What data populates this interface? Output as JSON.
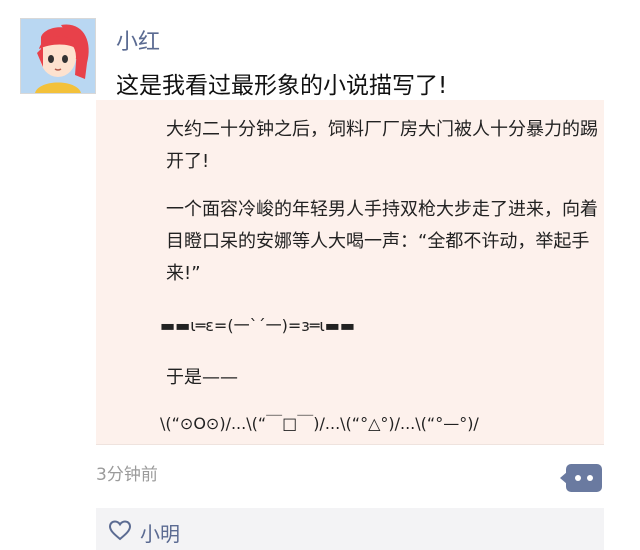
{
  "post": {
    "username": "小红",
    "text": "这是我看过最形象的小说描写了!",
    "timestamp": "3分钟前"
  },
  "image": {
    "paragraph1": "大约二十分钟之后，饲料厂厂房大门被人十分暴力的踢开了!",
    "paragraph2": "一个面容冷峻的年轻男人手持双枪大步走了进来，向着目瞪口呆的安娜等人大喝一声：“全都不许动，举起手来!”",
    "emoticon": "▬▬ι═ε=(一`´一)=з═ι▬▬",
    "paragraph3": "于是——",
    "reaction": "\\(“⊙O⊙)/...\\(“￣□￣)/...\\(“°△°)/...\\(“°—°)/"
  },
  "likes": {
    "names": "小明"
  },
  "icons": {
    "comment": "comment-icon",
    "like": "heart-icon"
  },
  "colors": {
    "name_link": "#5b6b92",
    "comment_button": "#6a7aa0",
    "image_background": "#fdf1ec",
    "likes_background": "#f3f3f5"
  }
}
